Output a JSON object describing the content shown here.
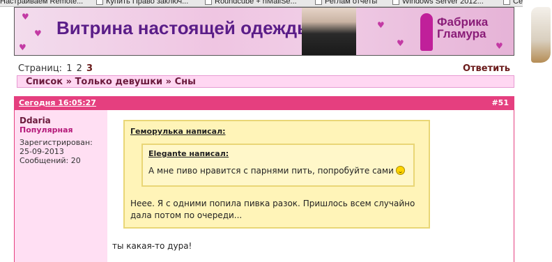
{
  "bookmarks": [
    {
      "label": "Настраиваем Remote...",
      "icon": "page-icon"
    },
    {
      "label": "Купить Право заключ...",
      "icon": "page-icon"
    },
    {
      "label": "Roundcube + nMailSe...",
      "icon": "page-icon"
    },
    {
      "label": "Реглам отчеты",
      "icon": "page-icon"
    },
    {
      "label": "Windows Server 2012...",
      "icon": "page-icon"
    },
    {
      "label": "Сервисны",
      "icon": "page-icon"
    }
  ],
  "banner": {
    "title": "Витрина настоящей одежды",
    "logo_line1": "Фабрика",
    "logo_line2": "Гламура"
  },
  "pagination": {
    "label": "Страниц:",
    "pages": [
      "1",
      "2"
    ],
    "current": "3"
  },
  "reply_label": "Ответить",
  "breadcrumb": {
    "items": [
      "Список",
      "Только девушки",
      "Сны"
    ],
    "separator": "»"
  },
  "post": {
    "date": "Сегодня 16:05:27",
    "number": "#51",
    "author": {
      "name": "Ddaria",
      "rank": "Популярная",
      "registered_label": "Зарегистрирован:",
      "registered_date": "25-09-2013",
      "messages_label": "Сообщений: 20"
    },
    "quote_outer": {
      "title": "Геморулька написал:",
      "text": "Неее. Я с одними попила пивка разок. Пришлось всем случайно дала потом по очереди..."
    },
    "quote_inner": {
      "title": "Elegante написал:",
      "text": "А мне пиво нравится с парнями пить, попробуйте сами"
    },
    "body": "ты какая-то дура!"
  },
  "colors": {
    "post_header": "#e53f7f",
    "author_bg": "#ffdff3",
    "quote_bg": "#fff4b8",
    "breadcrumb_bg": "#ffd7f2"
  }
}
